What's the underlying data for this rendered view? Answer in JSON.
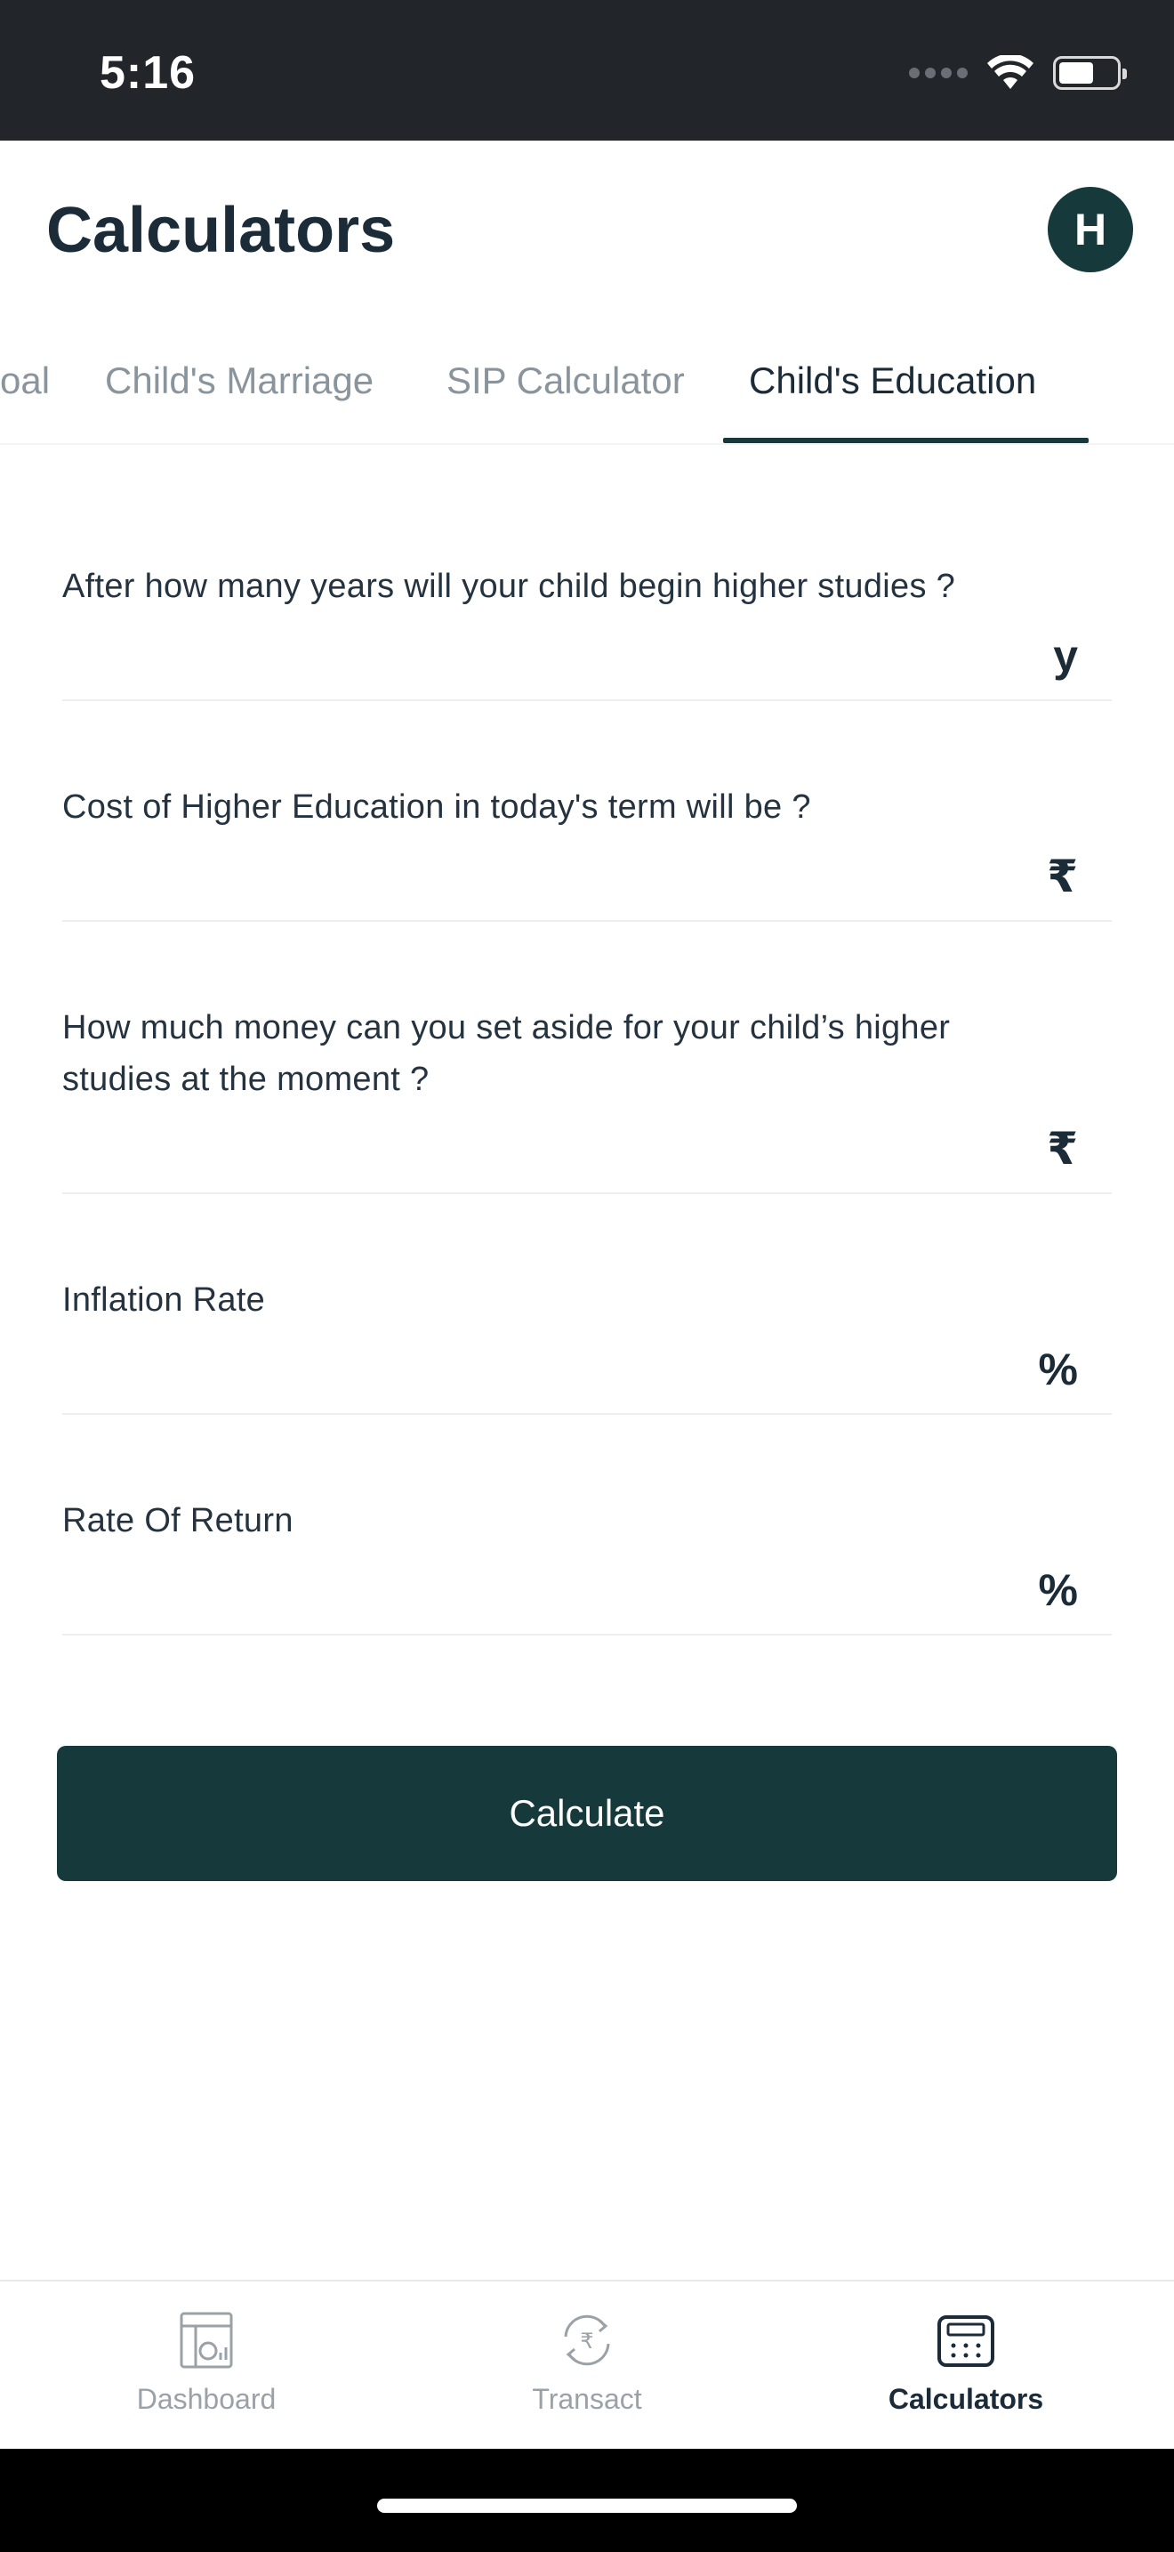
{
  "status_bar": {
    "time": "5:16"
  },
  "header": {
    "title": "Calculators",
    "avatar_initial": "H"
  },
  "tabs": [
    {
      "label": "oal"
    },
    {
      "label": "Child's Marriage"
    },
    {
      "label": "SIP Calculator"
    },
    {
      "label": "Child's Education"
    }
  ],
  "active_tab": "Child's Education",
  "form": {
    "fields": [
      {
        "label": "After how many years will your child begin higher studies ?",
        "value": "",
        "unit": "y"
      },
      {
        "label": "Cost of Higher Education in today's term will be ?",
        "value": "",
        "unit": "₹"
      },
      {
        "label": "How much money can you set aside for your child’s higher studies at the moment ?",
        "value": "",
        "unit": "₹"
      },
      {
        "label": "Inflation Rate",
        "value": "",
        "unit": "%"
      },
      {
        "label": "Rate Of Return",
        "value": "",
        "unit": "%"
      }
    ],
    "submit_label": "Calculate"
  },
  "bottom_nav": {
    "items": [
      {
        "label": "Dashboard",
        "icon": "dashboard-icon"
      },
      {
        "label": "Transact",
        "icon": "transact-icon"
      },
      {
        "label": "Calculators",
        "icon": "calculator-icon"
      }
    ],
    "active": "Calculators"
  },
  "colors": {
    "primary": "#163a3c",
    "text": "#1c2b38",
    "muted": "#8a949c",
    "status_bar": "#22262b"
  }
}
